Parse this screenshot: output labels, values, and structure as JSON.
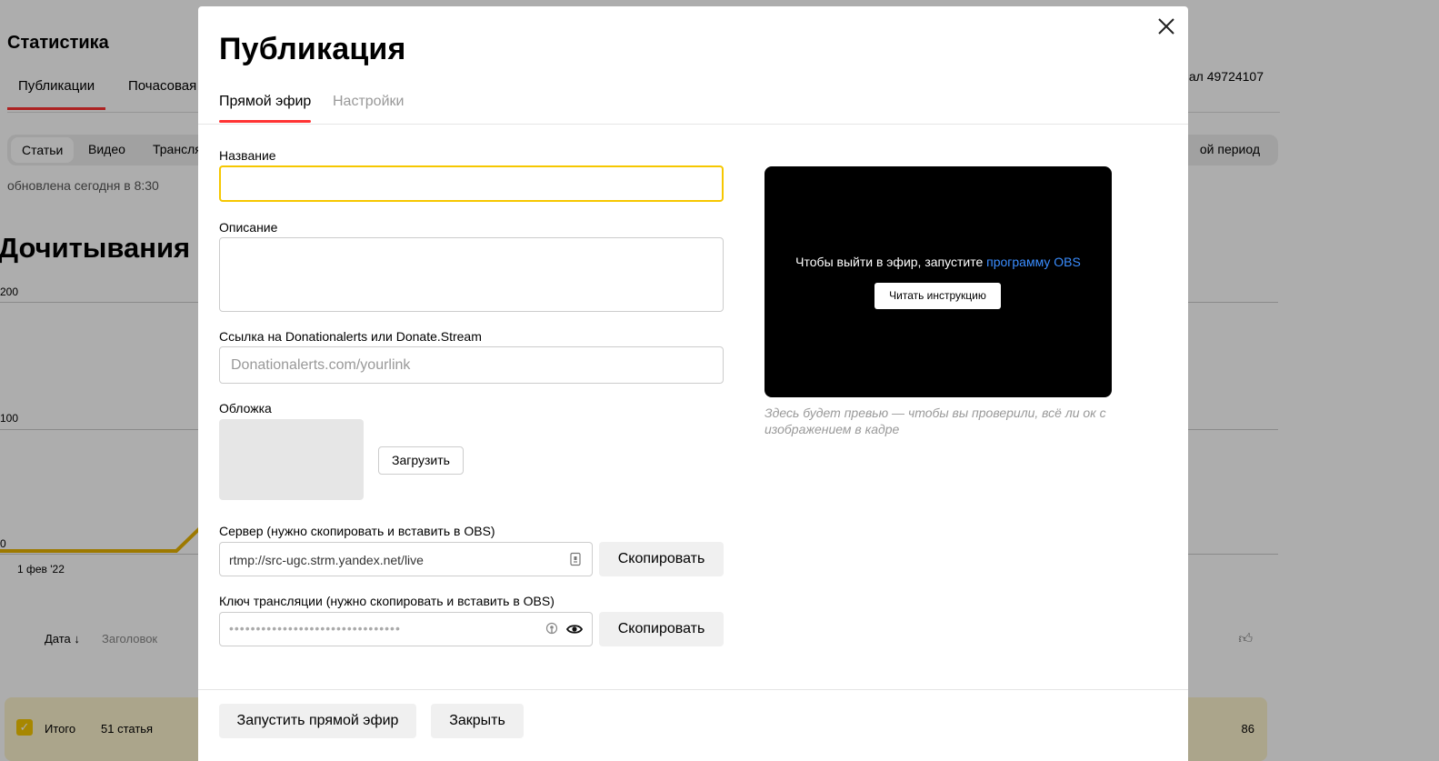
{
  "background": {
    "title": "Статистика",
    "tabs": [
      "Публикации",
      "Почасовая с"
    ],
    "channel": "ал 49724107",
    "filters": [
      "Статьи",
      "Видео",
      "Трансля"
    ],
    "period": "ой период",
    "updated": "обновлена сегодня в 8:30",
    "section_title": "Дочитывания",
    "y_ticks": [
      "200",
      "100",
      "0"
    ],
    "x_tick": "1 фев '22",
    "table_headers": {
      "date": "Дата",
      "title": "Заголовок"
    },
    "total": {
      "label": "Итого",
      "count": "51 статья",
      "value": "86"
    }
  },
  "modal": {
    "title": "Публикация",
    "tabs": [
      "Прямой эфир",
      "Настройки"
    ],
    "name_label": "Название",
    "name_value": "",
    "description_label": "Описание",
    "donate_label": "Ссылка на Donationalerts или Donate.Stream",
    "donate_placeholder": "Donationalerts.com/yourlink",
    "cover_label": "Обложка",
    "upload_label": "Загрузить",
    "server_label": "Сервер (нужно скопировать и вставить в OBS)",
    "server_value": "rtmp://src-ugc.strm.yandex.net/live",
    "key_label": "Ключ трансляции (нужно скопировать и вставить в OBS)",
    "key_masked": "••••••••••••••••••••••••••••••••",
    "copy_label": "Скопировать",
    "preview_text": "Чтобы выйти в эфир, запустите ",
    "preview_link": "программу OBS",
    "preview_button": "Читать инструкцию",
    "preview_note": "Здесь будет превью — чтобы вы проверили, всё ли ок с изображением в кадре",
    "start_button": "Запустить прямой эфир",
    "close_button": "Закрыть"
  },
  "colors": {
    "focus_border": "#f6c700",
    "tab_underline": "#ff3333",
    "link": "#3a8dff",
    "chart_line": "#e8b300"
  }
}
